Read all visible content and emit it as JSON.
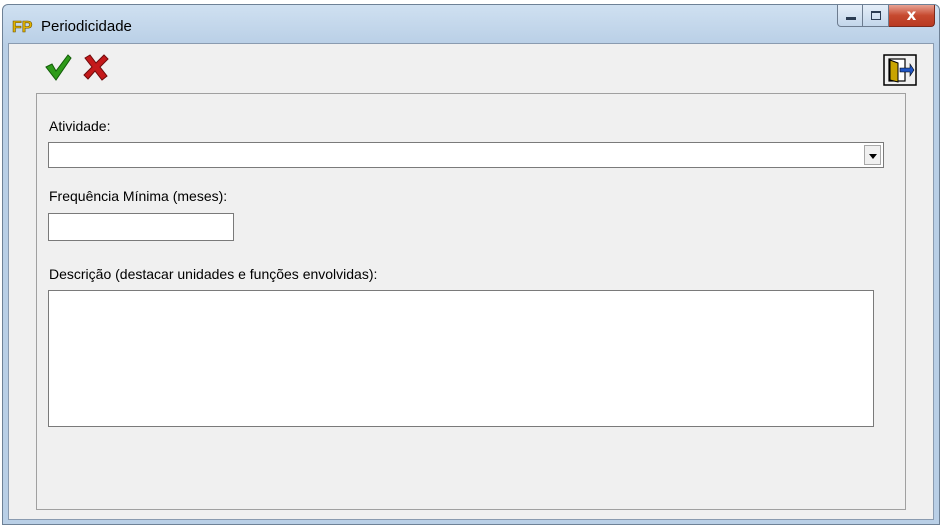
{
  "window": {
    "title": "Periodicidade"
  },
  "toolbar": {
    "confirm_icon": "green-checkmark-icon",
    "cancel_icon": "red-x-icon",
    "exit_icon": "exit-door-icon"
  },
  "form": {
    "activity": {
      "label": "Atividade:",
      "value": ""
    },
    "frequency": {
      "label": "Frequência Mínima (meses):",
      "value": ""
    },
    "description": {
      "label": "Descrição (destacar unidades e funções envolvidas):",
      "value": ""
    }
  },
  "colors": {
    "confirm": "#2e9b1a",
    "cancel": "#c4191b",
    "titlebar": "#b9cfe6"
  }
}
